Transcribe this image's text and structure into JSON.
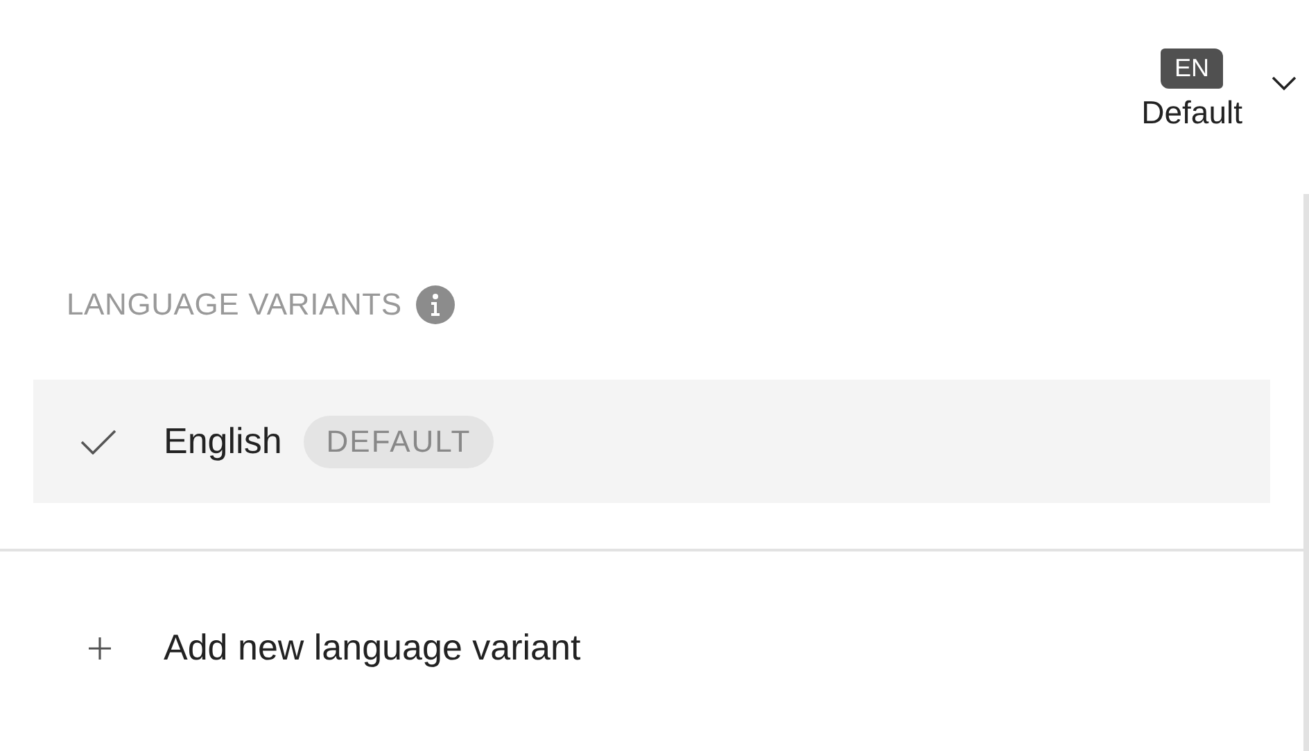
{
  "language_switcher": {
    "code": "EN",
    "label": "Default"
  },
  "menu": {
    "heading": "LANGUAGE VARIANTS",
    "variants": [
      {
        "name": "English",
        "badge": "DEFAULT",
        "selected": true
      }
    ],
    "add_action": "Add new language variant"
  }
}
